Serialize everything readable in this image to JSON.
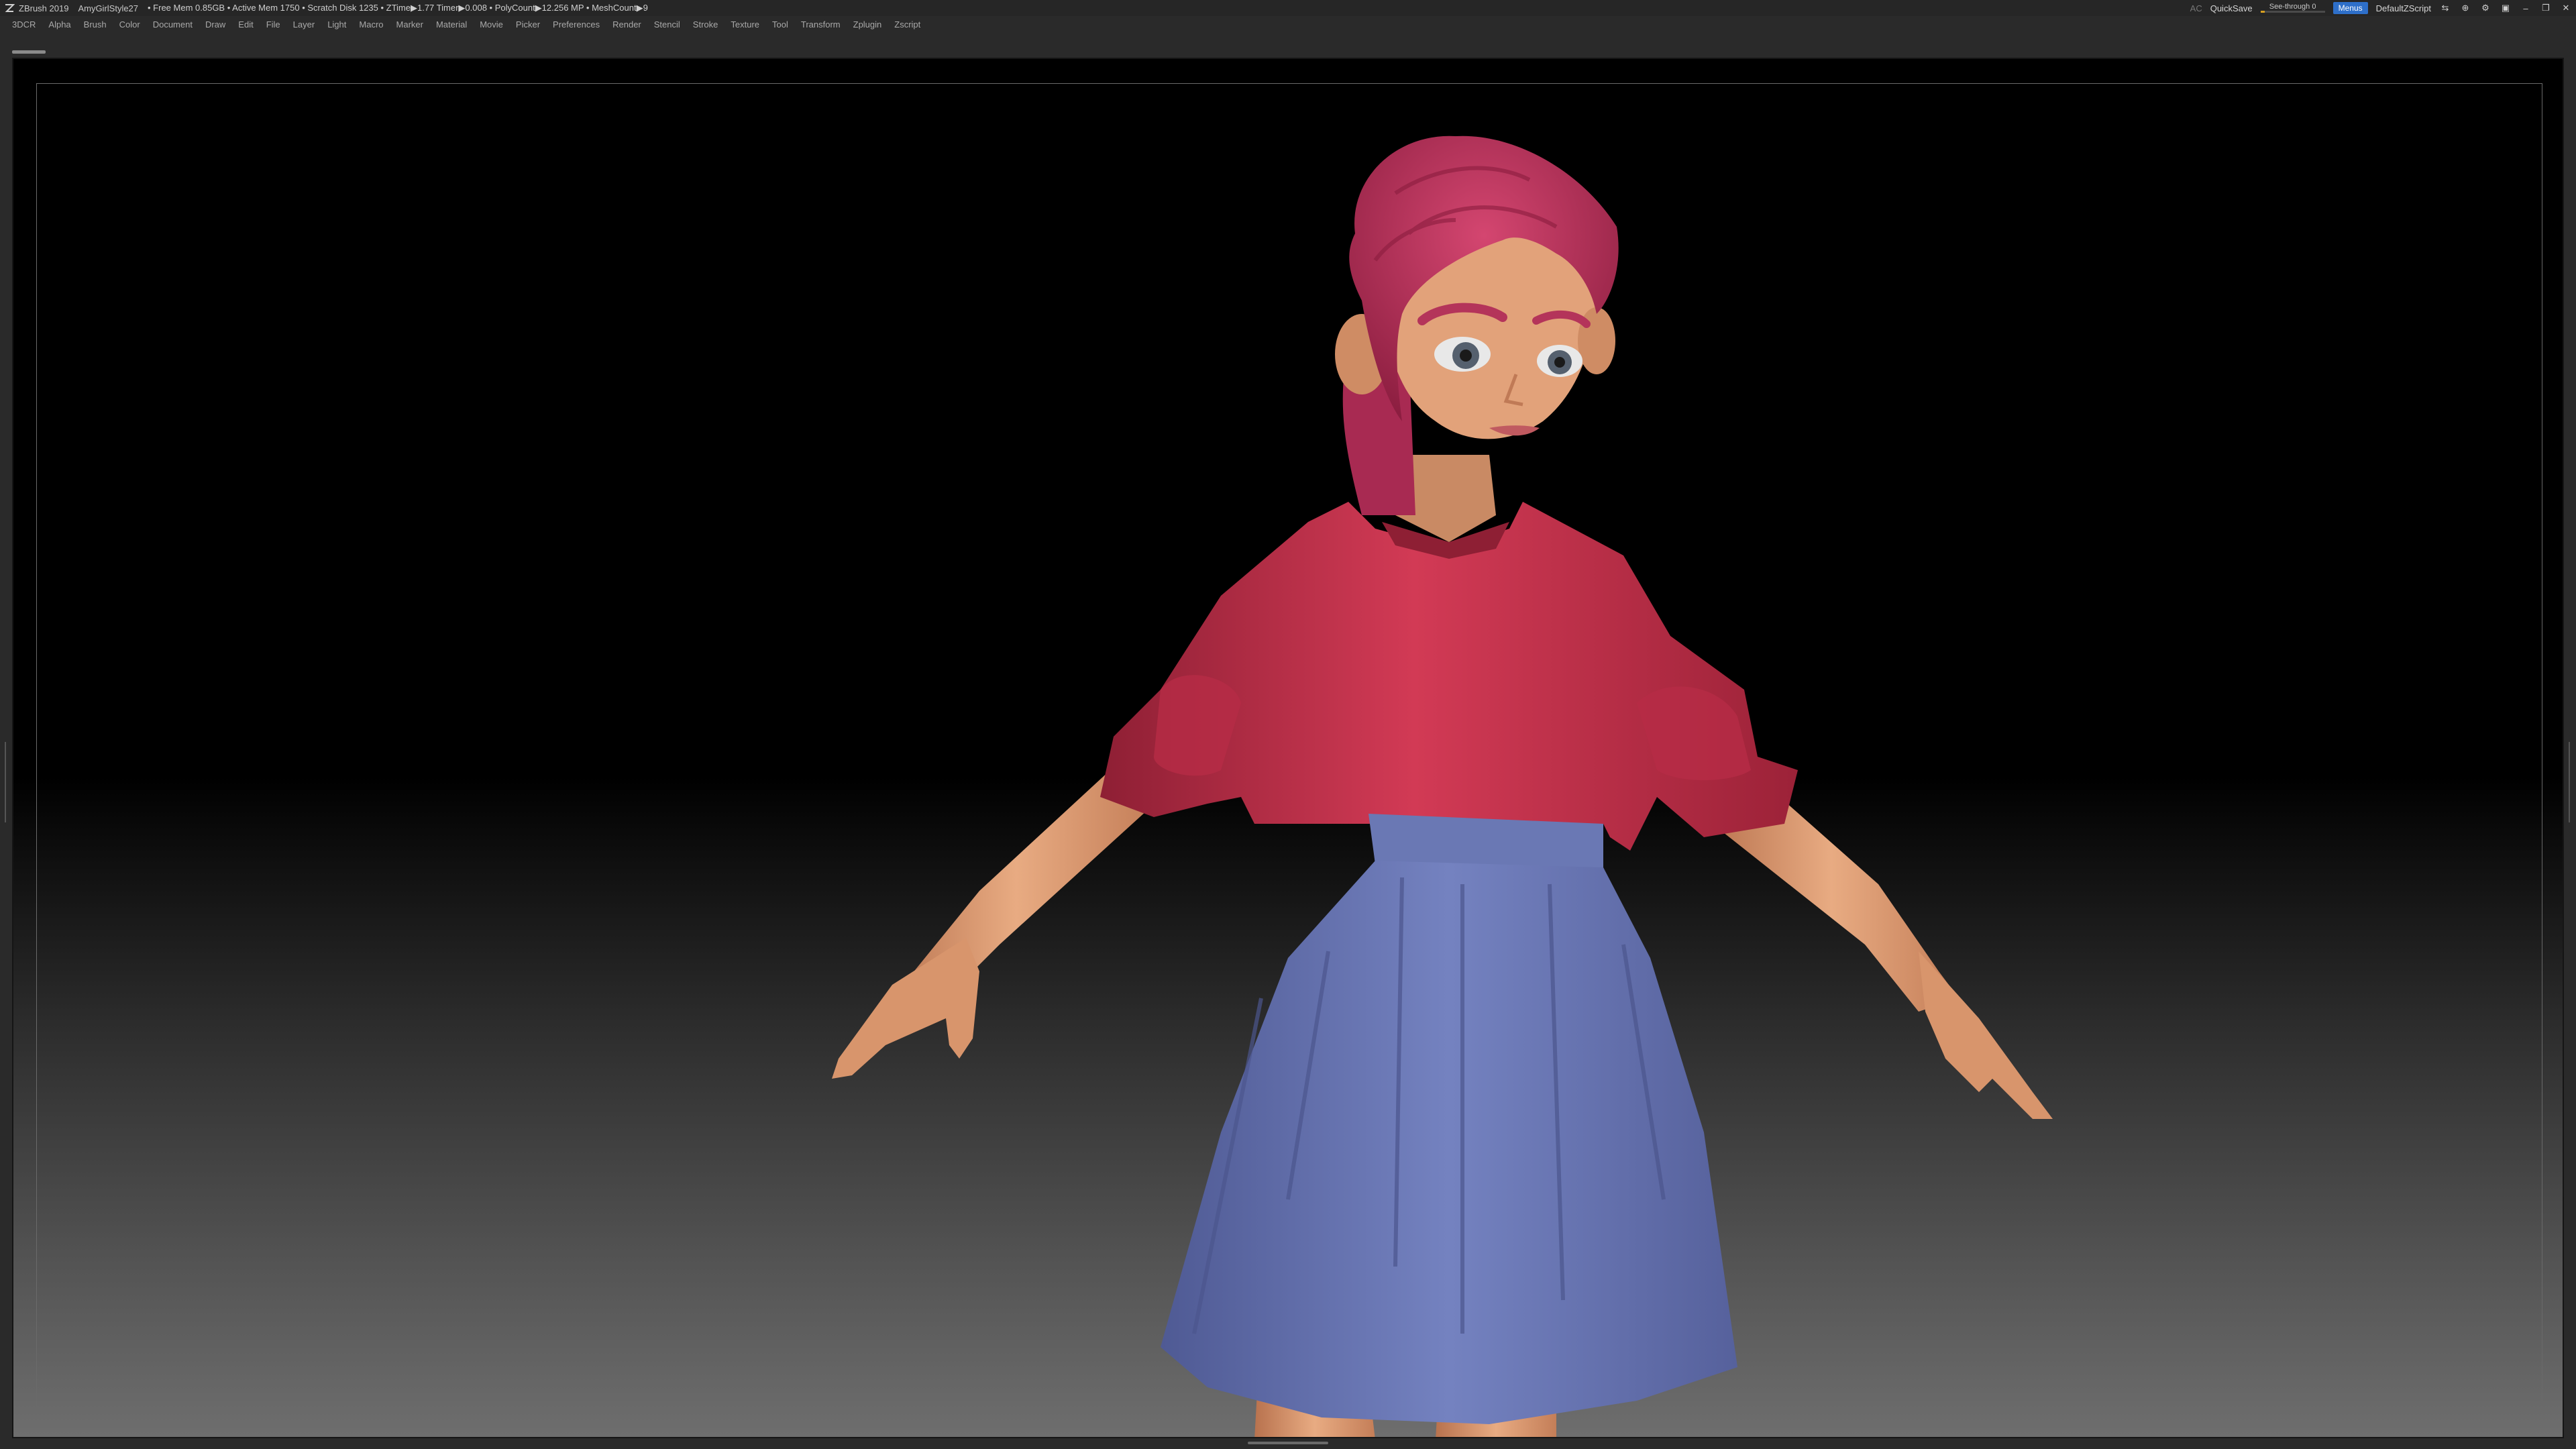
{
  "titlebar": {
    "app": "ZBrush 2019",
    "project": "AmyGirlStyle27",
    "status": "• Free Mem 0.85GB • Active Mem 1750 • Scratch Disk 1235 • ZTime▶1.77 Timer▶0.008 • PolyCount▶12.256 MP • MeshCount▶9",
    "ac": "AC",
    "quicksave": "QuickSave",
    "see_through": "See-through  0",
    "see_through_level": 0,
    "menus": "Menus",
    "default_zscript": "DefaultZScript"
  },
  "menubar": {
    "items": [
      "3DCR",
      "Alpha",
      "Brush",
      "Color",
      "Document",
      "Draw",
      "Edit",
      "File",
      "Layer",
      "Light",
      "Macro",
      "Marker",
      "Material",
      "Movie",
      "Picker",
      "Preferences",
      "Render",
      "Stencil",
      "Stroke",
      "Texture",
      "Tool",
      "Transform",
      "Zplugin",
      "Zscript"
    ]
  },
  "icons": {
    "logo": "zbrush-logo-icon",
    "window_controls": [
      "layout-icon",
      "help-icon",
      "script-icon",
      "lock-icon",
      "minimize-icon",
      "maximize-icon",
      "close-icon"
    ]
  },
  "colors": {
    "accent": "#2e6fc9",
    "slider": "#d8a020",
    "shirt": "#c2304a",
    "skirt": "#6a78b4",
    "hair": "#c2305a",
    "skin": "#e2a27a"
  }
}
